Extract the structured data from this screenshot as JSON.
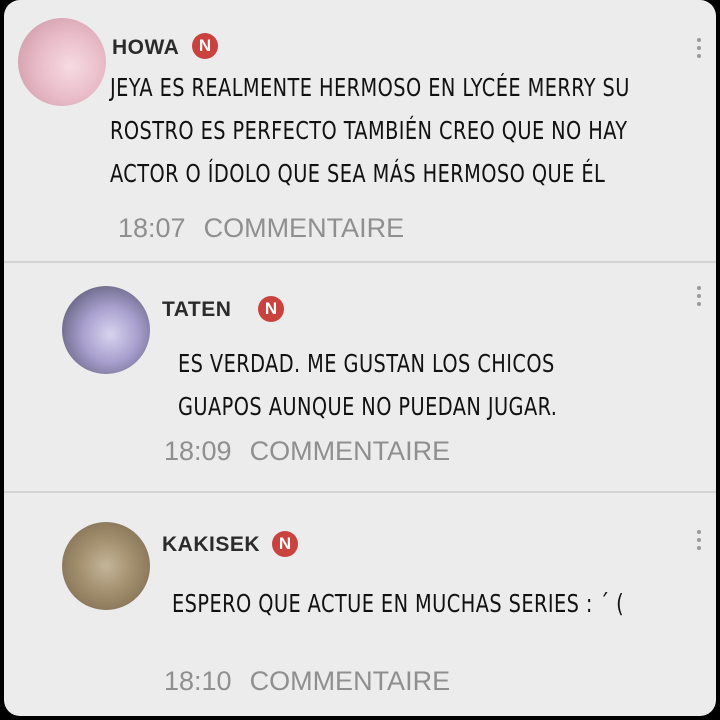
{
  "comments": [
    {
      "user": "HOWA",
      "badge": "N",
      "text_lines": [
        "JEYA ES REALMENTE HERMOSO EN LYCÉE MERRY SU",
        "ROSTRO ES PERFECTO TAMBIÉN CREO QUE NO HAY",
        "ACTOR O ÍDOLO QUE SEA MÁS HERMOSO QUE ÉL"
      ],
      "time": "18:07",
      "action": "COMMENTAIRE"
    },
    {
      "user": "TATEN",
      "badge": "N",
      "text_lines": [
        "ES VERDAD. ME GUSTAN LOS CHICOS",
        "GUAPOS AUNQUE NO PUEDAN JUGAR."
      ],
      "time": "18:09",
      "action": "COMMENTAIRE"
    },
    {
      "user": "KAKISEK",
      "badge": "N",
      "text_lines": [
        "ESPERO QUE ACTUE EN MUCHAS SERIES : ´ ("
      ],
      "time": "18:10",
      "action": "COMMENTAIRE"
    }
  ]
}
